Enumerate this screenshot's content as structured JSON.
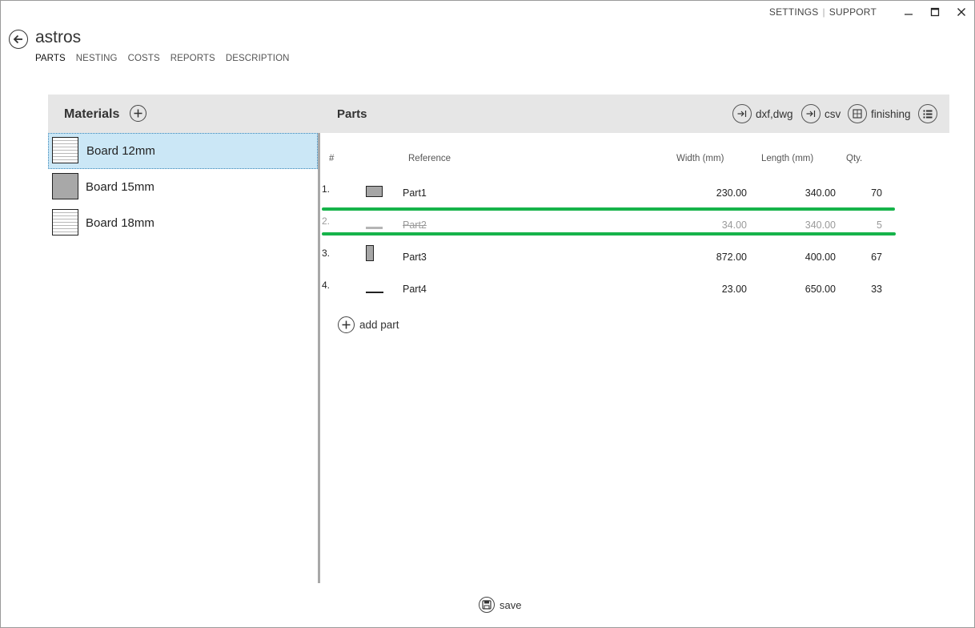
{
  "top_links": {
    "settings": "SETTINGS",
    "separator": "|",
    "support": "SUPPORT"
  },
  "app": {
    "title": "astros"
  },
  "tabs": [
    {
      "label": "PARTS",
      "active": true
    },
    {
      "label": "NESTING"
    },
    {
      "label": "COSTS"
    },
    {
      "label": "REPORTS"
    },
    {
      "label": "DESCRIPTION"
    }
  ],
  "materials": {
    "title": "Materials",
    "items": [
      {
        "label": "Board 12mm",
        "pattern": "lines",
        "selected": true
      },
      {
        "label": "Board 15mm",
        "pattern": "solid"
      },
      {
        "label": "Board 18mm",
        "pattern": "lines"
      }
    ]
  },
  "parts": {
    "title": "Parts",
    "toolbar": {
      "import_dxf": "dxf,dwg",
      "import_csv": "csv",
      "finishing": "finishing"
    },
    "columns": {
      "num": "#",
      "reference": "Reference",
      "width": "Width (mm)",
      "length": "Length (mm)",
      "qty": "Qty."
    },
    "rows": [
      {
        "num": "1.",
        "reference": "Part1",
        "width": "230.00",
        "length": "340.00",
        "qty": "70",
        "disabled": false
      },
      {
        "num": "2.",
        "reference": "Part2",
        "width": "34.00",
        "length": "340.00",
        "qty": "5",
        "disabled": true
      },
      {
        "num": "3.",
        "reference": "Part3",
        "width": "872.00",
        "length": "400.00",
        "qty": "67",
        "disabled": false
      },
      {
        "num": "4.",
        "reference": "Part4",
        "width": "23.00",
        "length": "650.00",
        "qty": "33",
        "disabled": false
      }
    ],
    "add_part": "add part"
  },
  "footer": {
    "save": "save"
  },
  "colors": {
    "selection": "#cbe7f6",
    "highlight_line": "#16b34a",
    "strip": "#e6e6e6"
  }
}
